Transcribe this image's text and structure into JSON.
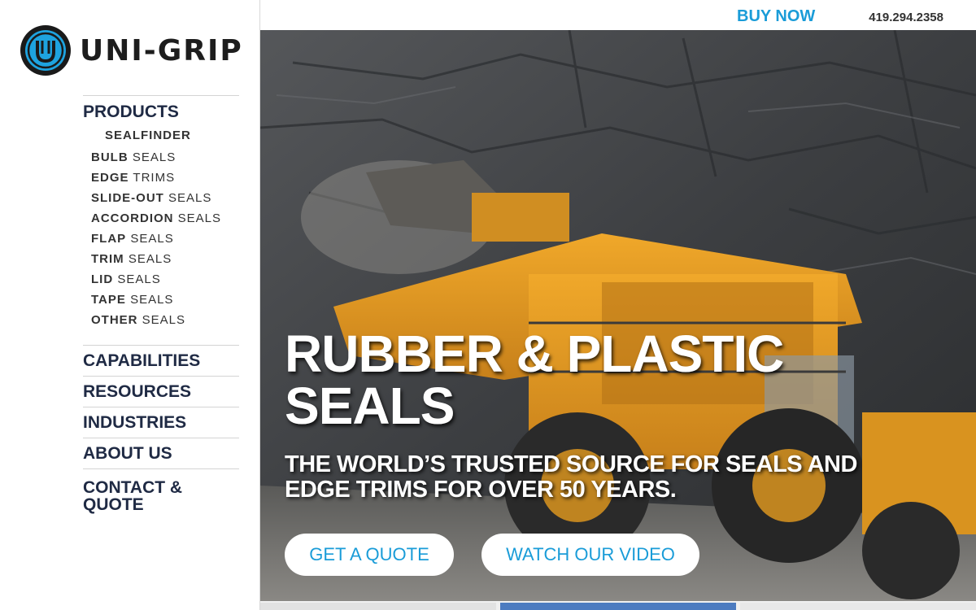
{
  "brand": {
    "name": "UNI-GRIP"
  },
  "header": {
    "buy_now": "BUY NOW",
    "phone": "419.294.2358"
  },
  "nav": {
    "products": "PRODUCTS",
    "sealfinder": "SEALFINDER",
    "items": [
      {
        "bold": "BULB",
        "rest": "SEALS"
      },
      {
        "bold": "EDGE",
        "rest": "TRIMS"
      },
      {
        "bold": "SLIDE-OUT",
        "rest": "SEALS"
      },
      {
        "bold": "ACCORDION",
        "rest": "SEALS"
      },
      {
        "bold": "FLAP",
        "rest": "SEALS"
      },
      {
        "bold": "TRIM",
        "rest": "SEALS"
      },
      {
        "bold": "LID",
        "rest": "SEALS"
      },
      {
        "bold": "TAPE",
        "rest": "SEALS"
      },
      {
        "bold": "OTHER",
        "rest": "SEALS"
      }
    ],
    "capabilities": "CAPABILITIES",
    "resources": "RESOURCES",
    "industries": "INDUSTRIES",
    "about": "ABOUT US",
    "contact": "CONTACT & QUOTE"
  },
  "hero": {
    "title": "RUBBER & PLASTIC SEALS",
    "subtitle": "THE WORLD’S TRUSTED SOURCE FOR SEALS AND EDGE TRIMS FOR OVER 50 YEARS.",
    "cta_quote": "GET A QUOTE",
    "cta_video": "WATCH OUR VIDEO"
  },
  "colors": {
    "accent": "#1a9cd8",
    "nav_text": "#1f2a44",
    "truck": "#e39a1f"
  },
  "icons": {
    "logo": "uni-grip-logo-icon"
  }
}
